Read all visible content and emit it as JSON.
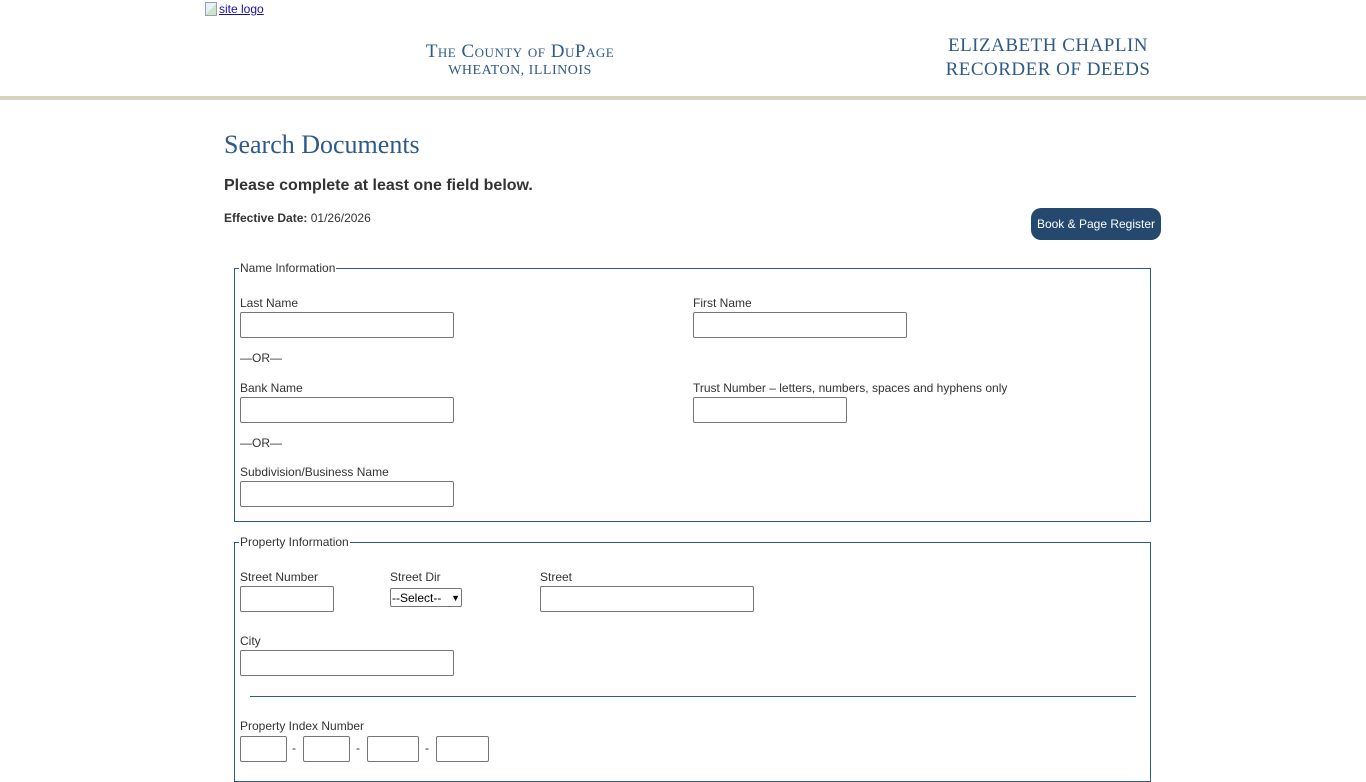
{
  "header": {
    "logo_alt": "site logo",
    "county_line1": "The County of DuPage",
    "county_line2": "WHEATON, ILLINOIS",
    "official_name": "ELIZABETH CHAPLIN",
    "official_title": "RECORDER OF DEEDS"
  },
  "main": {
    "title": "Search Documents",
    "instructions": "Please complete at least one field below.",
    "effective_label": "Effective Date:",
    "effective_value": "01/26/2026",
    "register_button": "Book & Page Register"
  },
  "name_info": {
    "legend": "Name Information",
    "last_name": {
      "label": "Last Name",
      "value": ""
    },
    "first_name": {
      "label": "First Name",
      "value": ""
    },
    "or1": "—OR—",
    "bank_name": {
      "label": "Bank Name",
      "value": ""
    },
    "trust_number": {
      "label": "Trust Number – letters, numbers, spaces and hyphens only",
      "value": ""
    },
    "or2": "—OR—",
    "subdivision": {
      "label": "Subdivision/Business Name",
      "value": ""
    }
  },
  "property_info": {
    "legend": "Property Information",
    "street_number": {
      "label": "Street Number",
      "value": ""
    },
    "street_dir": {
      "label": "Street Dir",
      "selected": "--Select--"
    },
    "street": {
      "label": "Street",
      "value": ""
    },
    "city": {
      "label": "City",
      "value": ""
    },
    "pin": {
      "label": "Property Index Number",
      "separator": "-",
      "parts": [
        "",
        "",
        "",
        ""
      ]
    }
  },
  "icons": {
    "broken_image": "broken-image-icon",
    "dropdown": "chevron-down-icon"
  },
  "colors": {
    "heading_blue": "#2e5a8a",
    "button_bg": "#24486e",
    "header_rule": "#d9d2c1"
  }
}
